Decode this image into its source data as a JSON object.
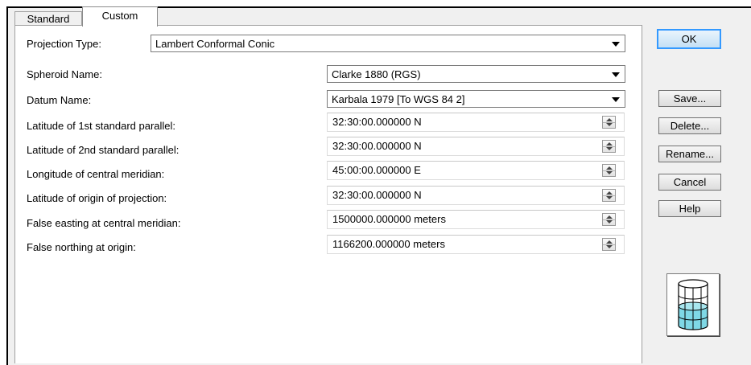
{
  "tabs": [
    {
      "label": "Standard",
      "active": false
    },
    {
      "label": "Custom",
      "active": true
    }
  ],
  "projection_type": {
    "label": "Projection Type:",
    "value": "Lambert Conformal Conic"
  },
  "spheroid": {
    "label": "Spheroid Name:",
    "value": "Clarke 1880 (RGS)"
  },
  "datum": {
    "label": "Datum Name:",
    "value": "Karbala 1979 [To WGS 84 2]"
  },
  "parameters": [
    {
      "label": "Latitude of 1st standard parallel:",
      "value": "32:30:00.000000 N"
    },
    {
      "label": "Latitude of 2nd standard parallel:",
      "value": "32:30:00.000000 N"
    },
    {
      "label": "Longitude of central meridian:",
      "value": "45:00:00.000000 E"
    },
    {
      "label": "Latitude of origin of projection:",
      "value": "32:30:00.000000 N"
    },
    {
      "label": "False easting at central meridian:",
      "value": "1500000.000000 meters"
    },
    {
      "label": "False northing at origin:",
      "value": "1166200.000000 meters"
    }
  ],
  "buttons": {
    "ok": "OK",
    "save": "Save...",
    "delete": "Delete...",
    "rename": "Rename...",
    "cancel": "Cancel",
    "help": "Help"
  },
  "preview_icon": "cylinder-projection-icon",
  "colors": {
    "default_button_border": "#3399ff",
    "cylinder_fill": "#7fd8e6"
  }
}
